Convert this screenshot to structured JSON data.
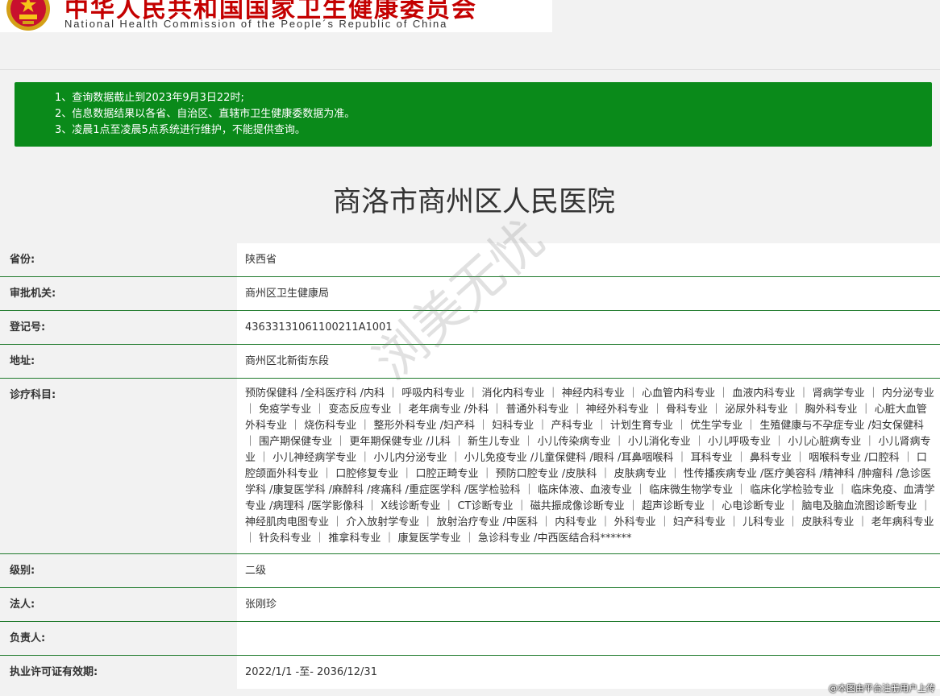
{
  "header": {
    "title_cn": "中华人民共和国国家卫生健康委员会",
    "title_en": "National Health Commission of the People´s Republic of China"
  },
  "notice": {
    "items": [
      "1、查询数据截止到2023年9月3日22时;",
      "2、信息数据结果以各省、自治区、直辖市卫生健康委数据为准。",
      "3、凌晨1点至凌晨5点系统进行维护，不能提供查询。"
    ]
  },
  "hospital": {
    "name": "商洛市商州区人民医院"
  },
  "fields": {
    "province": {
      "label": "省份:",
      "value": "陕西省"
    },
    "authority": {
      "label": "审批机关:",
      "value": "商州区卫生健康局"
    },
    "reg_no": {
      "label": "登记号:",
      "value": "43633131061100211A1001"
    },
    "address": {
      "label": "地址:",
      "value": "商州区北新街东段"
    },
    "departments": {
      "label": "诊疗科目:",
      "value": "预防保健科 /全科医疗科 /内科 ｜ 呼吸内科专业 ｜ 消化内科专业 ｜ 神经内科专业 ｜ 心血管内科专业 ｜ 血液内科专业 ｜ 肾病学专业 ｜ 内分泌专业 ｜ 免疫学专业 ｜ 变态反应专业 ｜ 老年病专业 /外科 ｜ 普通外科专业 ｜ 神经外科专业 ｜ 骨科专业 ｜ 泌尿外科专业 ｜ 胸外科专业 ｜ 心脏大血管外科专业 ｜ 烧伤科专业 ｜ 整形外科专业 /妇产科 ｜ 妇科专业 ｜ 产科专业 ｜ 计划生育专业 ｜ 优生学专业 ｜ 生殖健康与不孕症专业 /妇女保健科 ｜ 围产期保健专业 ｜ 更年期保健专业 /儿科 ｜ 新生儿专业 ｜ 小儿传染病专业 ｜ 小儿消化专业 ｜ 小儿呼吸专业 ｜ 小儿心脏病专业 ｜ 小儿肾病专业 ｜ 小儿神经病学专业 ｜ 小儿内分泌专业 ｜ 小儿免疫专业 /儿童保健科 /眼科 /耳鼻咽喉科 ｜ 耳科专业 ｜ 鼻科专业 ｜ 咽喉科专业 /口腔科 ｜ 口腔颌面外科专业 ｜ 口腔修复专业 ｜ 口腔正畸专业 ｜ 预防口腔专业 /皮肤科 ｜ 皮肤病专业 ｜ 性传播疾病专业 /医疗美容科 /精神科 /肿瘤科 /急诊医学科 /康复医学科 /麻醉科 /疼痛科 /重症医学科 /医学检验科 ｜ 临床体液、血液专业 ｜ 临床微生物学专业 ｜ 临床化学检验专业 ｜ 临床免疫、血清学专业 /病理科 /医学影像科 ｜ X线诊断专业 ｜ CT诊断专业 ｜ 磁共振成像诊断专业 ｜ 超声诊断专业 ｜ 心电诊断专业 ｜ 脑电及脑血流图诊断专业 ｜ 神经肌肉电图专业 ｜ 介入放射学专业 ｜ 放射治疗专业 /中医科 ｜ 内科专业 ｜ 外科专业 ｜ 妇产科专业 ｜ 儿科专业 ｜ 皮肤科专业 ｜ 老年病科专业 ｜ 针灸科专业 ｜ 推拿科专业 ｜ 康复医学专业 ｜ 急诊科专业 /中西医结合科******"
    },
    "level": {
      "label": "级别:",
      "value": "二级"
    },
    "legal_person": {
      "label": "法人:",
      "value": "张刚珍"
    },
    "principal": {
      "label": "负责人:",
      "value": ""
    },
    "validity": {
      "label": "执业许可证有效期:",
      "value": "2022/1/1 -至- 2036/12/31"
    }
  },
  "watermark": "浏美无忧",
  "corner_note": "@本图由平台注册用户上传",
  "colors": {
    "notice_bg": "#0a8a1a",
    "row_border": "#1f7a2c",
    "banner_red": "#c40000"
  }
}
